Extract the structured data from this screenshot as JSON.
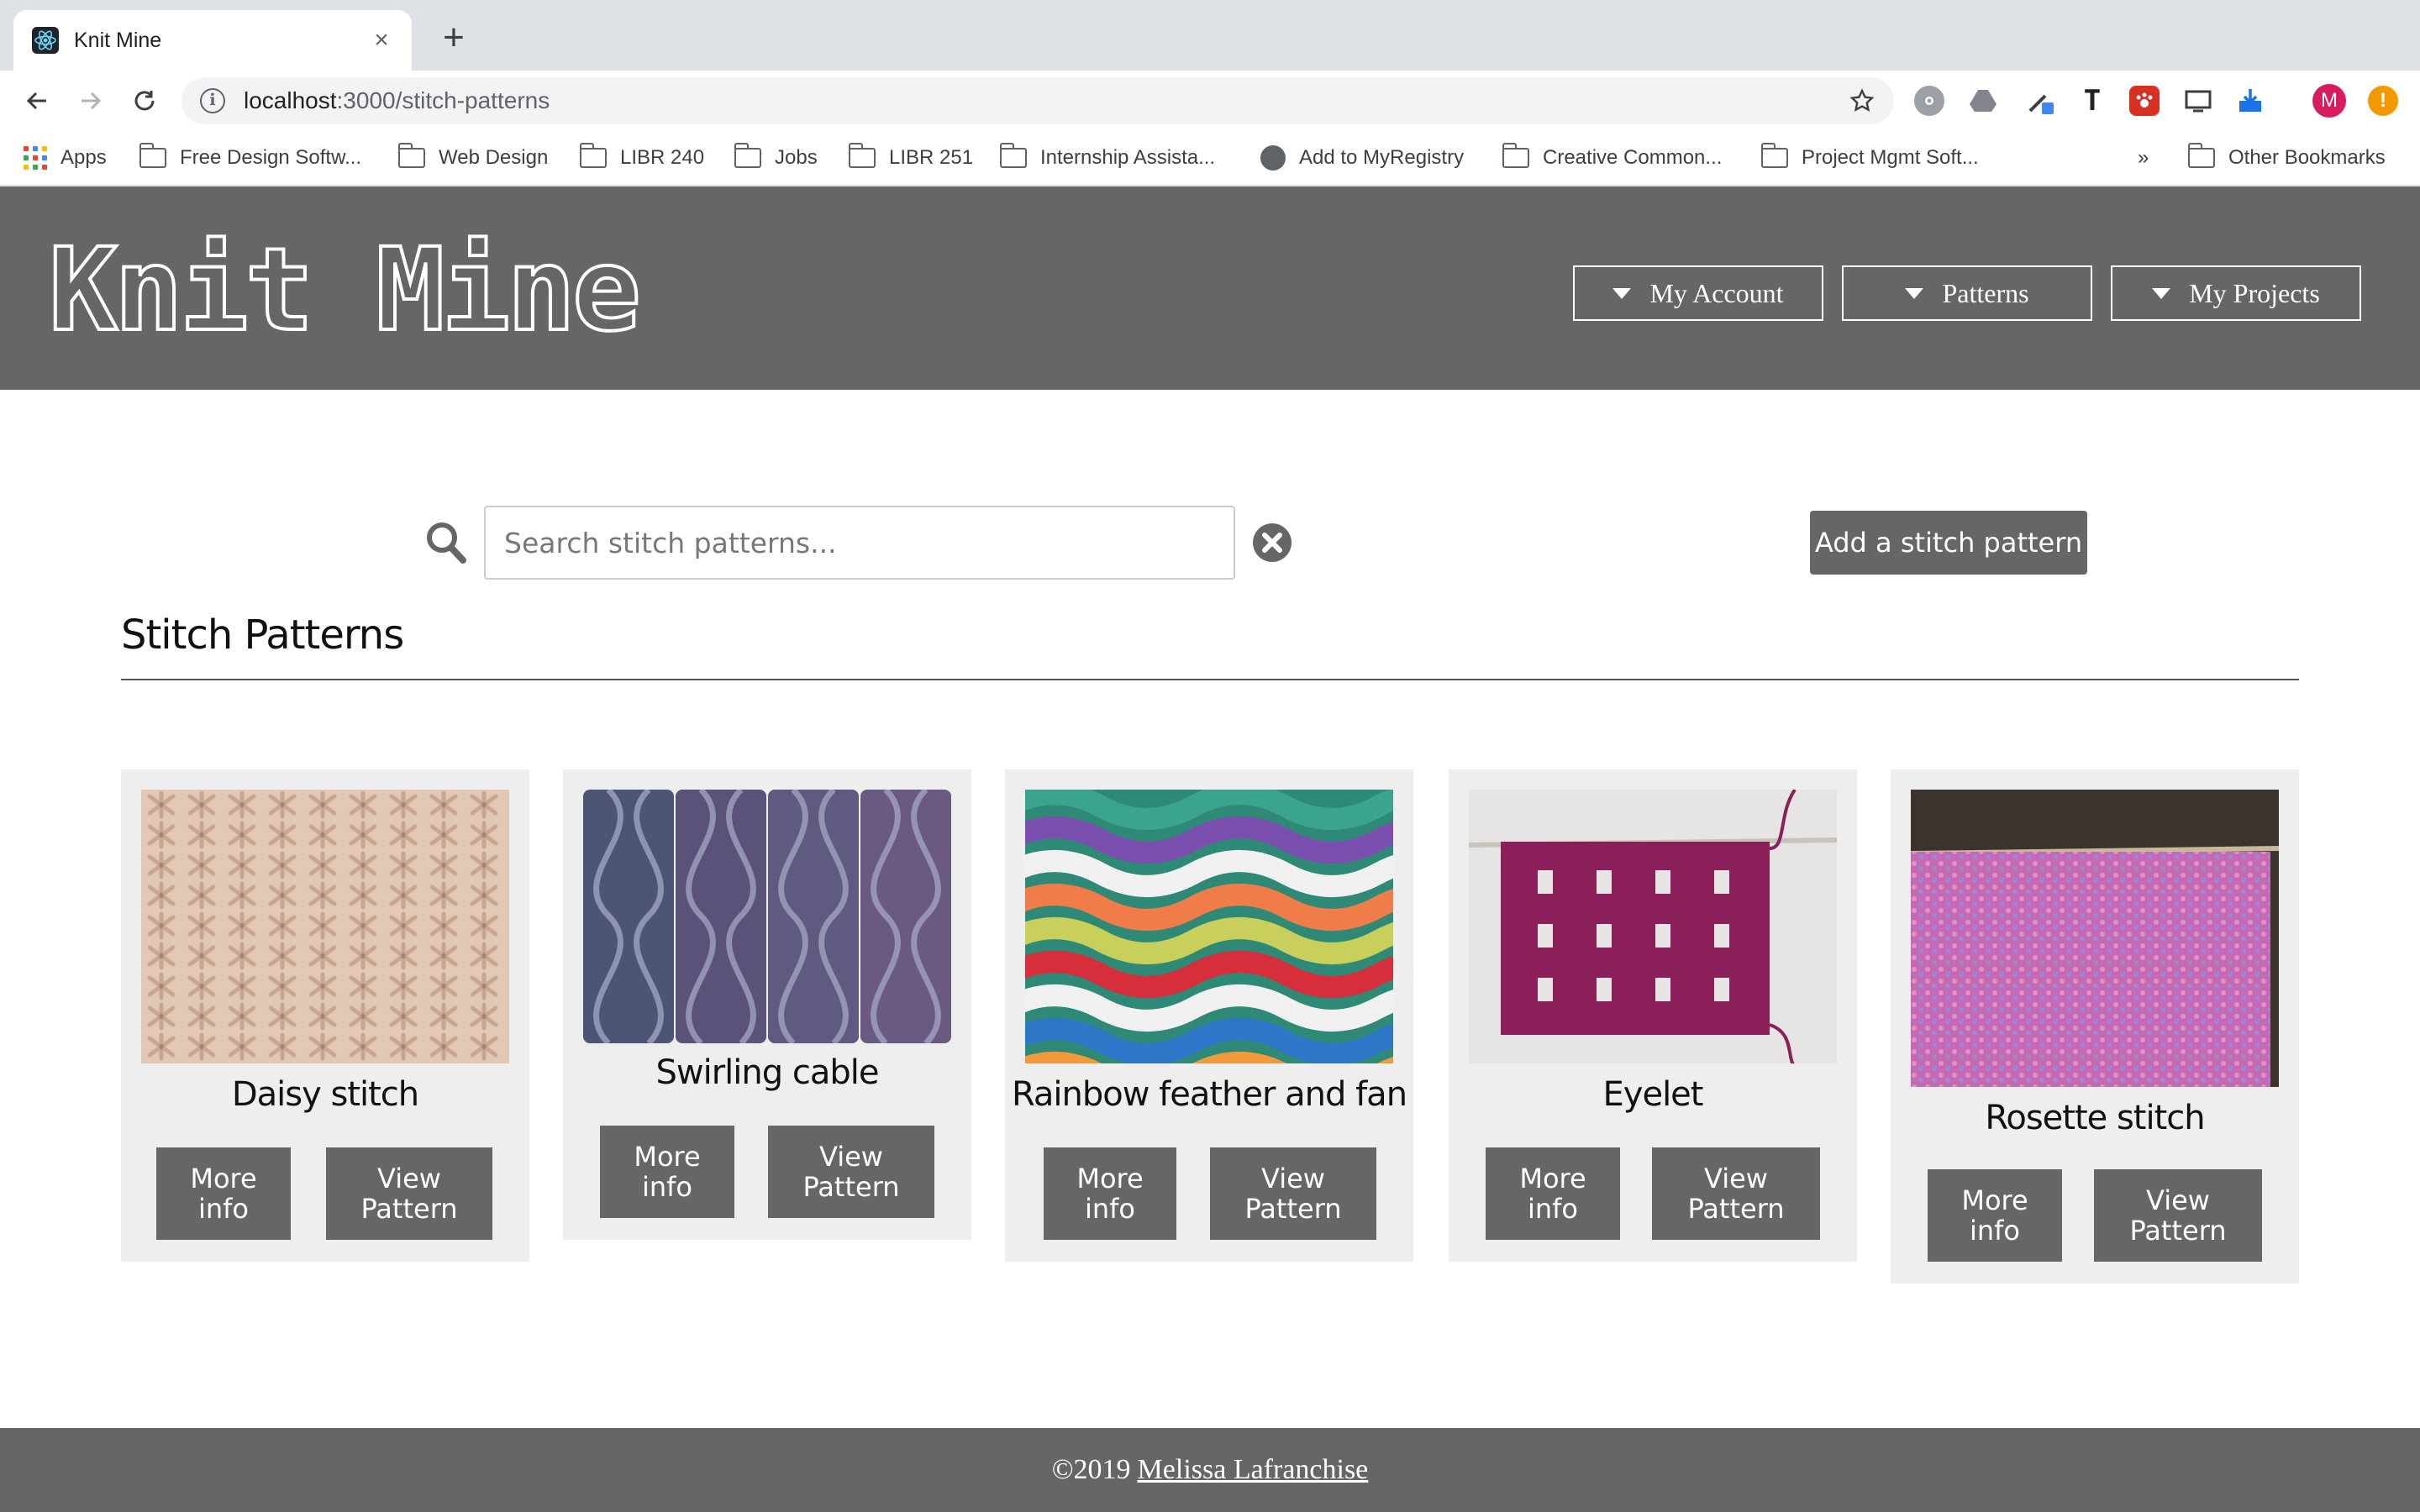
{
  "browser": {
    "tab_title": "Knit Mine",
    "url_host": "localhost",
    "url_path": ":3000/stitch-patterns",
    "bookmarks": [
      {
        "label": "Apps",
        "icon": "apps-grid-icon"
      },
      {
        "label": "Free Design Softw...",
        "icon": "folder-icon"
      },
      {
        "label": "Web Design",
        "icon": "folder-icon"
      },
      {
        "label": "LIBR 240",
        "icon": "folder-icon"
      },
      {
        "label": "Jobs",
        "icon": "folder-icon"
      },
      {
        "label": "LIBR 251",
        "icon": "folder-icon"
      },
      {
        "label": "Internship Assista...",
        "icon": "folder-icon"
      },
      {
        "label": "Add to MyRegistry",
        "icon": "globe-icon"
      },
      {
        "label": "Creative Common...",
        "icon": "folder-icon"
      },
      {
        "label": "Project Mgmt Soft...",
        "icon": "folder-icon"
      }
    ],
    "bookmarks_overflow": "»",
    "other_bookmarks": "Other Bookmarks",
    "profile_initial": "M"
  },
  "site": {
    "logo": "Knit Mine",
    "nav": {
      "my_account": "My Account",
      "patterns": "Patterns",
      "my_projects": "My Projects"
    }
  },
  "search": {
    "placeholder": "Search stitch patterns...",
    "value": ""
  },
  "add_button_label": "Add a stitch pattern",
  "section_title": "Stitch Patterns",
  "patterns": [
    {
      "name": "Daisy stitch",
      "more_info": "More info",
      "view": "View Pattern",
      "image": "daisy-stitch-knit-swatch"
    },
    {
      "name": "Swirling cable",
      "more_info": "More info",
      "view": "View Pattern",
      "image": "swirling-cable-knit-swatch"
    },
    {
      "name": "Rainbow feather and fan",
      "more_info": "More info",
      "view": "View Pattern",
      "image": "rainbow-feather-fan-knit-swatch"
    },
    {
      "name": "Eyelet",
      "more_info": "More info",
      "view": "View Pattern",
      "image": "eyelet-knit-swatch"
    },
    {
      "name": "Rosette stitch",
      "more_info": "More info",
      "view": "View Pattern",
      "image": "rosette-stitch-knit-swatch"
    }
  ],
  "footer": {
    "copyright": "©2019",
    "author": "Melissa Lafranchise"
  },
  "colors": {
    "header_bg": "#666666",
    "button_bg": "#666666",
    "card_bg": "#eeeeee"
  }
}
